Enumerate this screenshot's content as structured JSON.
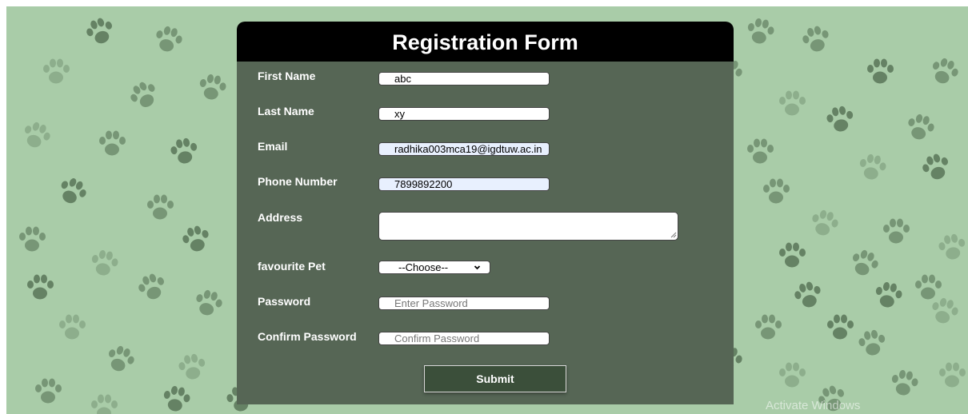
{
  "form": {
    "title": "Registration Form",
    "fields": [
      {
        "label": "First Name",
        "value": "abc",
        "placeholder": "",
        "type": "text"
      },
      {
        "label": "Last Name",
        "value": "xy",
        "placeholder": "",
        "type": "text"
      },
      {
        "label": "Email",
        "value": "radhika003mca19@igdtuw.ac.in",
        "placeholder": "",
        "type": "email"
      },
      {
        "label": "Phone Number",
        "value": "7899892200",
        "placeholder": "",
        "type": "tel"
      },
      {
        "label": "Address",
        "value": "",
        "placeholder": "",
        "type": "textarea"
      },
      {
        "label": "favourite Pet",
        "value": "--Choose--",
        "type": "select"
      },
      {
        "label": "Password",
        "value": "",
        "placeholder": "Enter Password",
        "type": "password"
      },
      {
        "label": "Confirm Password",
        "value": "",
        "placeholder": "Confirm Password",
        "type": "password"
      }
    ],
    "submit_label": "Submit"
  },
  "os": {
    "watermark": "Activate Windows"
  },
  "icons": {
    "background_pattern": "paw-print-icon",
    "select_arrow": "chevron-down-icon",
    "resize_handle": "resize-grip-icon"
  },
  "colors": {
    "page_background": "#a9cca8",
    "form_panel": "#566655",
    "header": "#000000",
    "submit_button": "#3b4f3a",
    "autofill": "#e8f0fe"
  }
}
